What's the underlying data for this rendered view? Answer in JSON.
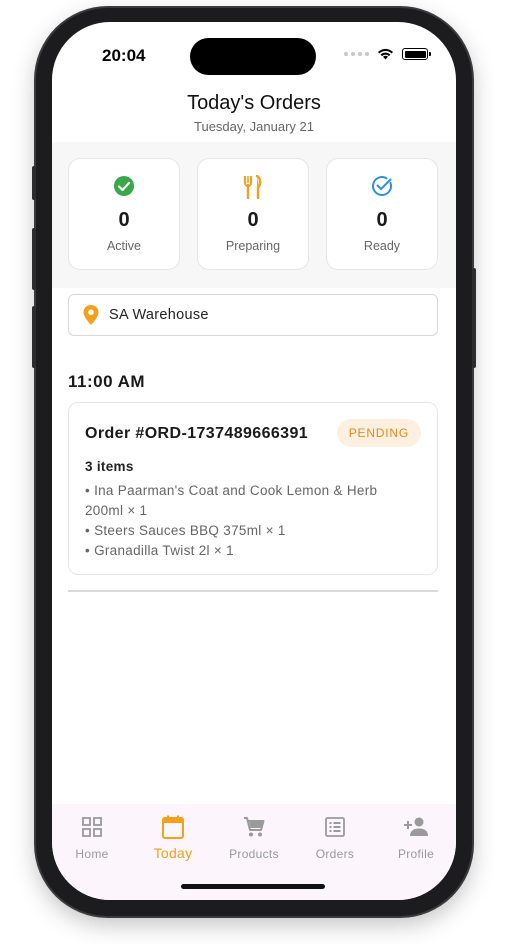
{
  "status_bar": {
    "time": "20:04"
  },
  "header": {
    "title": "Today's Orders",
    "date": "Tuesday, January 21"
  },
  "stats": [
    {
      "value": "0",
      "label": "Active",
      "icon": "check-circle-icon",
      "color": "#3aa84a"
    },
    {
      "value": "0",
      "label": "Preparing",
      "icon": "fork-knife-icon",
      "color": "#f5a01a"
    },
    {
      "value": "0",
      "label": "Ready",
      "icon": "circle-check-outline-icon",
      "color": "#2b8fe8"
    }
  ],
  "warehouse": {
    "label": "SA Warehouse",
    "icon": "location-pin-icon",
    "color": "#f5a01a"
  },
  "time_group": "11:00 AM",
  "order": {
    "id": "Order #ORD-1737489666391",
    "status": "PENDING",
    "item_count": "3 items",
    "items": [
      "• Ina Paarman's Coat and Cook Lemon & Herb",
      "200ml × 1",
      "• Steers Sauces BBQ 375ml × 1",
      "• Granadilla Twist 2l × 1"
    ]
  },
  "tabs": [
    {
      "label": "Home",
      "icon": "grid-icon"
    },
    {
      "label": "Today",
      "icon": "calendar-icon",
      "active": true
    },
    {
      "label": "Products",
      "icon": "cart-icon"
    },
    {
      "label": "Orders",
      "icon": "list-icon"
    },
    {
      "label": "Profile",
      "icon": "add-person-icon"
    }
  ],
  "colors": {
    "accent": "#f5a01a",
    "tab_inactive": "#9a9a9a",
    "tab_bar_bg": "#fcf5fb"
  }
}
